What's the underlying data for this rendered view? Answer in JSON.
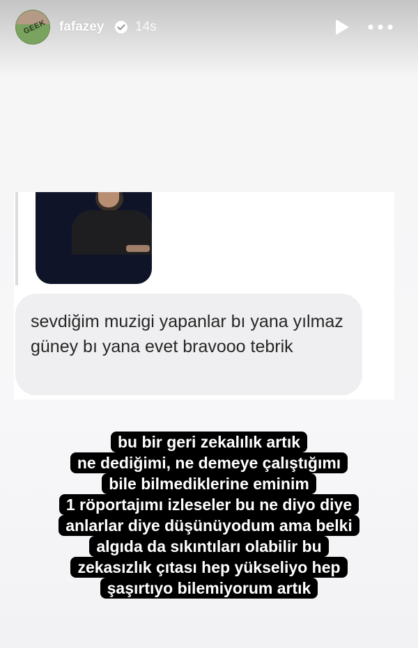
{
  "header": {
    "username": "fafazey",
    "time_ago": "14s",
    "avatar_text": "GEEK",
    "verified_icon": "verified-badge-icon",
    "play_icon": "play-icon",
    "more_icon": "more-dots-icon"
  },
  "shared_message": {
    "text": "sevdiğim muzigi yapanlar bı yana yılmaz güney bı yana evet bravooo tebrik"
  },
  "caption": {
    "lines": [
      "bu bir geri zekalılık artık",
      "ne dediğimi, ne demeye çalıştığımı",
      "bile bilmediklerine eminim",
      "1 röportajımı izleseler bu ne diyo diye",
      "anlarlar diye düşünüyodum ama belki",
      "algıda da sıkıntıları olabilir bu",
      "zekasızlık çıtası hep yükseliyo hep",
      "şaşırtıyo bilemiyorum artık"
    ]
  },
  "colors": {
    "caption_bg": "#000000",
    "caption_text": "#ffffff",
    "bubble_bg": "#efeff1",
    "bubble_text": "#262626"
  }
}
